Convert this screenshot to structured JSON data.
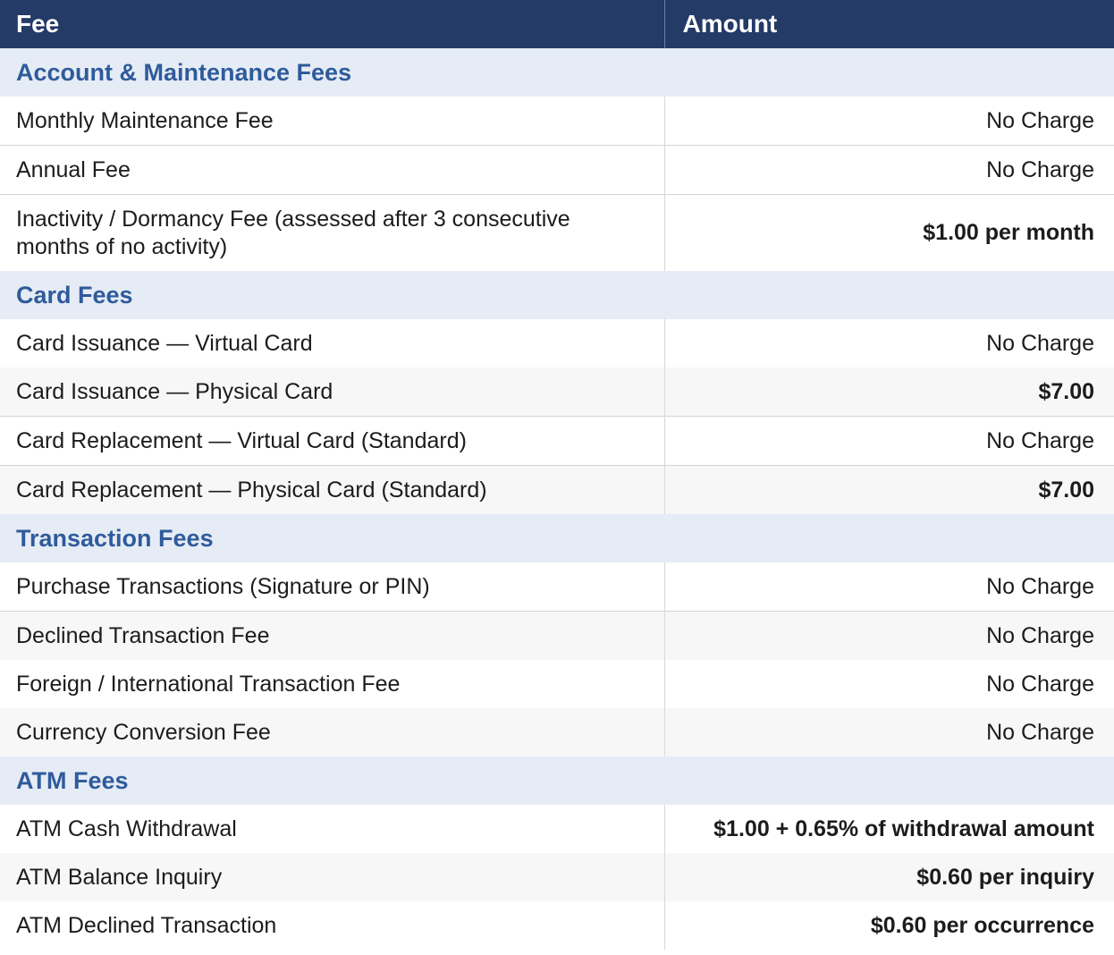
{
  "header": {
    "fee": "Fee",
    "amount": "Amount"
  },
  "sections": [
    {
      "title": "Account & Maintenance Fees",
      "rows": [
        {
          "fee": "Monthly Maintenance Fee",
          "amount": "No Charge"
        },
        {
          "fee": "Annual Fee",
          "amount": "No Charge"
        },
        {
          "fee": "Inactivity / Dormancy Fee (assessed after 3 consecutive months of no activity)",
          "amount": "$1.00 per month"
        }
      ]
    },
    {
      "title": "Card Fees",
      "rows": [
        {
          "fee": "Card Issuance — Virtual Card",
          "amount": "No Charge"
        },
        {
          "fee": "Card Issuance — Physical Card",
          "amount": "$7.00"
        },
        {
          "fee": "Card Replacement — Virtual Card (Standard)",
          "amount": "No Charge"
        },
        {
          "fee": "Card Replacement — Physical Card (Standard)",
          "amount": "$7.00"
        }
      ]
    },
    {
      "title": "Transaction Fees",
      "rows": [
        {
          "fee": "Purchase Transactions (Signature or PIN)",
          "amount": "No Charge"
        },
        {
          "fee": "Declined Transaction Fee",
          "amount": "No Charge"
        },
        {
          "fee": "Foreign / International Transaction Fee",
          "amount": "No Charge"
        },
        {
          "fee": "Currency Conversion Fee",
          "amount": "No Charge"
        }
      ]
    },
    {
      "title": "ATM Fees",
      "rows": [
        {
          "fee": "ATM Cash Withdrawal",
          "amount": "$1.00 + 0.65% of withdrawal amount"
        },
        {
          "fee": "ATM Balance Inquiry",
          "amount": "$0.60 per inquiry"
        },
        {
          "fee": "ATM Declined Transaction",
          "amount": "$0.60 per occurrence"
        }
      ]
    }
  ]
}
